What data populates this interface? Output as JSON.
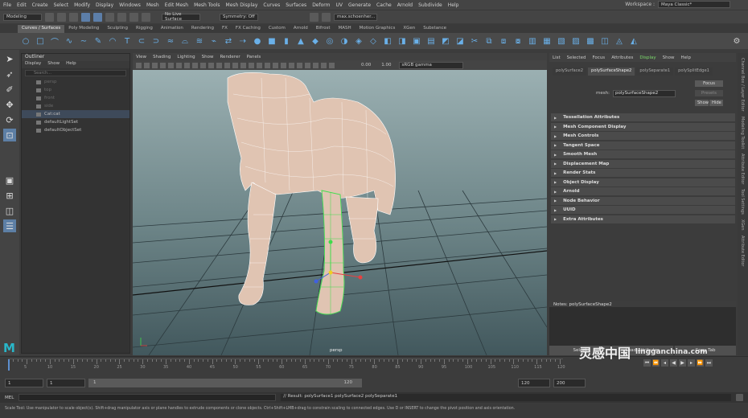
{
  "menubar": {
    "items": [
      "File",
      "Edit",
      "Create",
      "Select",
      "Modify",
      "Display",
      "Windows",
      "Mesh",
      "Edit Mesh",
      "Mesh Tools",
      "Mesh Display",
      "Curves",
      "Surfaces",
      "Deform",
      "UV",
      "Generate",
      "Cache",
      "Arnold",
      "Subdivide",
      "Help"
    ],
    "workspace_label": "Workspace :",
    "workspace_value": "Maya Classic*"
  },
  "statusline": {
    "mode": "Modeling",
    "live_surface": "No Live Surface",
    "symmetry": "Symmetry: Off",
    "user": "max.schoenher..."
  },
  "shelf": {
    "tabs": [
      "Curves / Surfaces",
      "Poly Modeling",
      "Sculpting",
      "Rigging",
      "Animation",
      "Rendering",
      "FX",
      "FX Caching",
      "Custom",
      "Arnold",
      "Bifrost",
      "MASH",
      "Motion Graphics",
      "XGen",
      "Substance"
    ],
    "active_tab": 0
  },
  "outliner": {
    "title": "Outliner",
    "menu": [
      "Display",
      "Show",
      "Help"
    ],
    "search_placeholder": "Search...",
    "items": [
      {
        "label": "persp",
        "dim": true
      },
      {
        "label": "top",
        "dim": true
      },
      {
        "label": "front",
        "dim": true
      },
      {
        "label": "side",
        "dim": true
      },
      {
        "label": "Cat:cat",
        "dim": false,
        "selected": true
      },
      {
        "label": "defaultLightSet",
        "dim": false
      },
      {
        "label": "defaultObjectSet",
        "dim": false
      }
    ]
  },
  "viewport": {
    "menu": [
      "View",
      "Shading",
      "Lighting",
      "Show",
      "Renderer",
      "Panels"
    ],
    "exposure": "0.00",
    "gamma": "1.00",
    "colorspace": "sRGB gamma",
    "camera_label": "persp"
  },
  "attribute_editor": {
    "menu": [
      "List",
      "Selected",
      "Focus",
      "Attributes",
      "Display",
      "Show",
      "Help"
    ],
    "tabs": [
      "polySurface2",
      "polySurfaceShape2",
      "polySeparate1",
      "polySplitEdge1"
    ],
    "active_tab": 1,
    "mesh_label": "mesh:",
    "mesh_value": "polySurfaceShape2",
    "focus_btn": "Focus",
    "presets_btn": "Presets",
    "show_btn": "Show",
    "hide_btn": "Hide",
    "sections": [
      "Tessellation Attributes",
      "Mesh Component Display",
      "Mesh Controls",
      "Tangent Space",
      "Smooth Mesh",
      "Displacement Map",
      "Render Stats",
      "Object Display",
      "Arnold",
      "Node Behavior",
      "UUID",
      "Extra Attributes"
    ],
    "notes_label": "Notes: polySurfaceShape2",
    "bottom_buttons": [
      "Select",
      "Load Attributes",
      "Copy Tab"
    ]
  },
  "right_tabs": [
    "Channel Box / Layer Editor",
    "Modeling Toolkit",
    "Attribute Editor",
    "Tool Settings",
    "XGen",
    "Attribute Editor"
  ],
  "timeline": {
    "ticks": [
      "5",
      "10",
      "15",
      "20",
      "25",
      "30",
      "35",
      "40",
      "45",
      "50",
      "55",
      "60",
      "65",
      "70",
      "75",
      "80",
      "85",
      "90",
      "95",
      "100",
      "105",
      "110",
      "115",
      "120"
    ],
    "current_frame": "1"
  },
  "range": {
    "start": "1",
    "playback_start": "1",
    "slider_start": "1",
    "slider_end": "120",
    "playback_end": "120",
    "end": "200"
  },
  "cmdline": {
    "lang": "MEL",
    "result": "// Result: polySurface1 polySurface2 polySeparate1"
  },
  "helpline": {
    "text": "Scale Tool: Use manipulator to scale object(s). Shift+drag manipulator axis or plane handles to extrude components or clone objects. Ctrl+Shift+LMB+drag to constrain scaling to connected edges. Use D or INSERT to change the pivot position and axis orientation."
  },
  "logo": {
    "text": "M"
  },
  "watermark": {
    "text": "灵感中国",
    "url": "lingganchina.com"
  },
  "colors": {
    "accent": "#5d7fa5",
    "display_highlight": "#7cdc6c",
    "mesh_skin": "#e0c4b2",
    "selection_green": "#3fdc4a"
  }
}
